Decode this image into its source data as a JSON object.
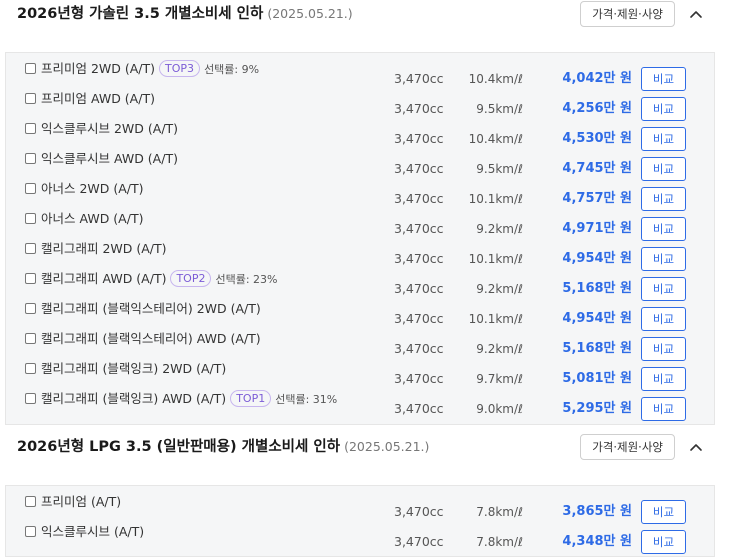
{
  "sections": [
    {
      "title": "2026년형 가솔린 3.5 개별소비세 인하",
      "date": "(2025.05.21.)",
      "spec_button": "가격·제원·사양",
      "rows": [
        {
          "name": "프리미엄 2WD (A/T)",
          "badge": "TOP3",
          "rate": "선택률: 9%",
          "cc": "3,470cc",
          "fuel": "10.4km/ℓ",
          "price": "4,042만 원",
          "compare": "비교"
        },
        {
          "name": "프리미엄 AWD (A/T)",
          "badge": "",
          "rate": "",
          "cc": "3,470cc",
          "fuel": "9.5km/ℓ",
          "price": "4,256만 원",
          "compare": "비교"
        },
        {
          "name": "익스클루시브 2WD (A/T)",
          "badge": "",
          "rate": "",
          "cc": "3,470cc",
          "fuel": "10.4km/ℓ",
          "price": "4,530만 원",
          "compare": "비교"
        },
        {
          "name": "익스클루시브 AWD (A/T)",
          "badge": "",
          "rate": "",
          "cc": "3,470cc",
          "fuel": "9.5km/ℓ",
          "price": "4,745만 원",
          "compare": "비교"
        },
        {
          "name": "아너스 2WD (A/T)",
          "badge": "",
          "rate": "",
          "cc": "3,470cc",
          "fuel": "10.1km/ℓ",
          "price": "4,757만 원",
          "compare": "비교"
        },
        {
          "name": "아너스 AWD (A/T)",
          "badge": "",
          "rate": "",
          "cc": "3,470cc",
          "fuel": "9.2km/ℓ",
          "price": "4,971만 원",
          "compare": "비교"
        },
        {
          "name": "캘리그래피 2WD (A/T)",
          "badge": "",
          "rate": "",
          "cc": "3,470cc",
          "fuel": "10.1km/ℓ",
          "price": "4,954만 원",
          "compare": "비교"
        },
        {
          "name": "캘리그래피 AWD (A/T)",
          "badge": "TOP2",
          "rate": "선택률: 23%",
          "cc": "3,470cc",
          "fuel": "9.2km/ℓ",
          "price": "5,168만 원",
          "compare": "비교"
        },
        {
          "name": "캘리그래피 (블랙익스테리어) 2WD (A/T)",
          "badge": "",
          "rate": "",
          "cc": "3,470cc",
          "fuel": "10.1km/ℓ",
          "price": "4,954만 원",
          "compare": "비교"
        },
        {
          "name": "캘리그래피 (블랙익스테리어) AWD (A/T)",
          "badge": "",
          "rate": "",
          "cc": "3,470cc",
          "fuel": "9.2km/ℓ",
          "price": "5,168만 원",
          "compare": "비교"
        },
        {
          "name": "캘리그래피 (블랙잉크) 2WD (A/T)",
          "badge": "",
          "rate": "",
          "cc": "3,470cc",
          "fuel": "9.7km/ℓ",
          "price": "5,081만 원",
          "compare": "비교"
        },
        {
          "name": "캘리그래피 (블랙잉크) AWD (A/T)",
          "badge": "TOP1",
          "rate": "선택률: 31%",
          "cc": "3,470cc",
          "fuel": "9.0km/ℓ",
          "price": "5,295만 원",
          "compare": "비교"
        }
      ]
    },
    {
      "title": "2026년형 LPG 3.5 (일반판매용) 개별소비세 인하",
      "date": "(2025.05.21.)",
      "spec_button": "가격·제원·사양",
      "rows": [
        {
          "name": "프리미엄 (A/T)",
          "badge": "",
          "rate": "",
          "cc": "3,470cc",
          "fuel": "7.8km/ℓ",
          "price": "3,865만 원",
          "compare": "비교"
        },
        {
          "name": "익스클루시브 (A/T)",
          "badge": "",
          "rate": "",
          "cc": "3,470cc",
          "fuel": "7.8km/ℓ",
          "price": "4,348만 원",
          "compare": "비교"
        }
      ]
    }
  ],
  "icons": {
    "collapse": "chevron-up-icon"
  },
  "colors": {
    "accent": "#2e6be6",
    "badge": "#7c5cd6",
    "panel_bg": "#f5f6f7"
  }
}
